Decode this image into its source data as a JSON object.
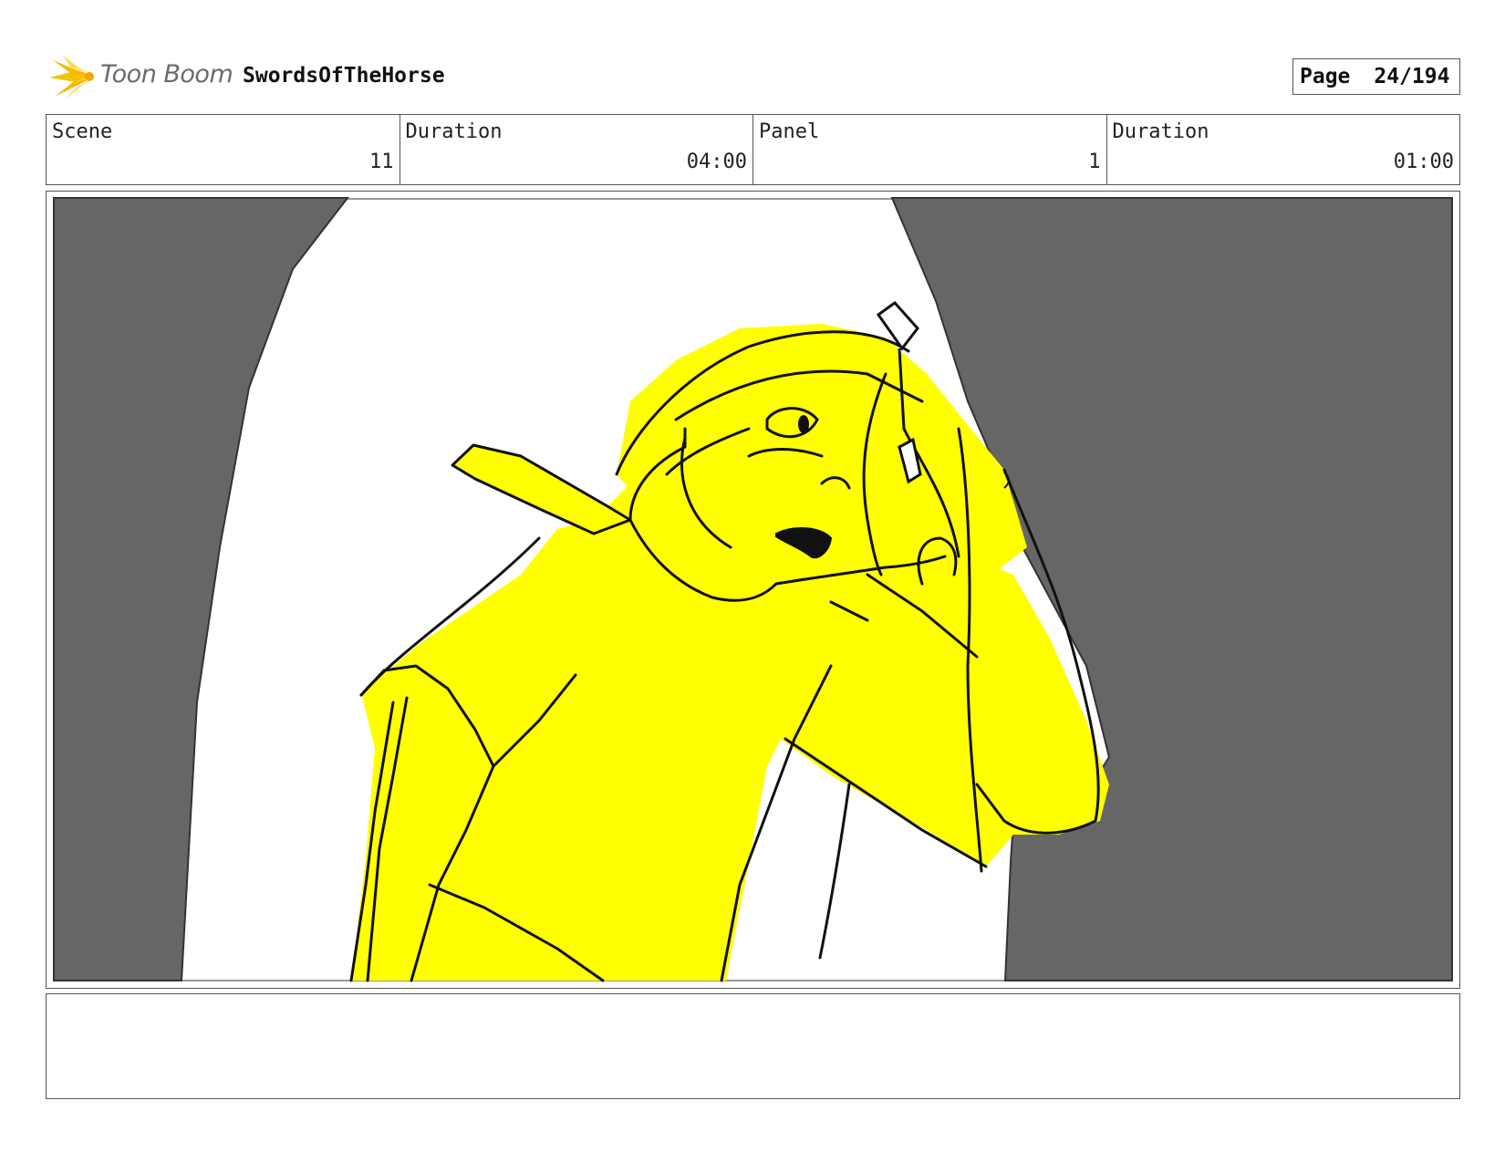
{
  "header": {
    "logo_text": "Toon Boom",
    "project_title": "SwordsOfTheHorse",
    "page_label": "Page",
    "page_number": "24/194"
  },
  "info": {
    "scene_label": "Scene",
    "scene_value": "11",
    "scene_duration_label": "Duration",
    "scene_duration_value": "04:00",
    "panel_label": "Panel",
    "panel_value": "1",
    "panel_duration_label": "Duration",
    "panel_duration_value": "01:00"
  },
  "colors": {
    "curtain": "#666666",
    "character_fill": "#ffff00",
    "line": "#111111",
    "logo_accent": "#f5c400"
  },
  "notes": {
    "text": ""
  }
}
